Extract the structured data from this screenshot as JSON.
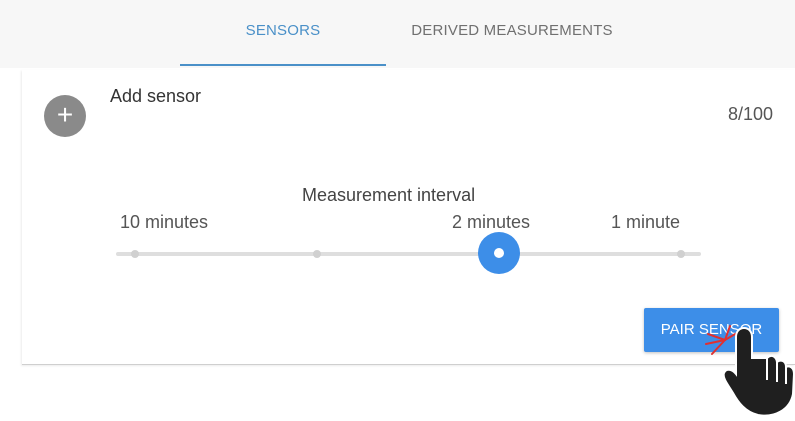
{
  "tabs": {
    "sensors_label": "SENSORS",
    "derived_label": "DERIVED MEASUREMENTS",
    "active": "sensors"
  },
  "sensor_card": {
    "add_icon": "plus-icon",
    "add_label": "Add sensor",
    "count": "8/100"
  },
  "interval": {
    "title": "Measurement interval",
    "tick_labels": [
      "10 minutes",
      "2 minutes",
      "1 minute"
    ],
    "selected": "2 minutes"
  },
  "actions": {
    "pair_label": "PAIR SENSOR",
    "cursor_icon": "hand-pointer-icon"
  },
  "colors": {
    "accent": "#3d8ee8",
    "tab_active": "#4a90c8",
    "tab_inactive": "#707070",
    "add_circle": "#8a8a8a",
    "click_spark": "#e03030"
  }
}
